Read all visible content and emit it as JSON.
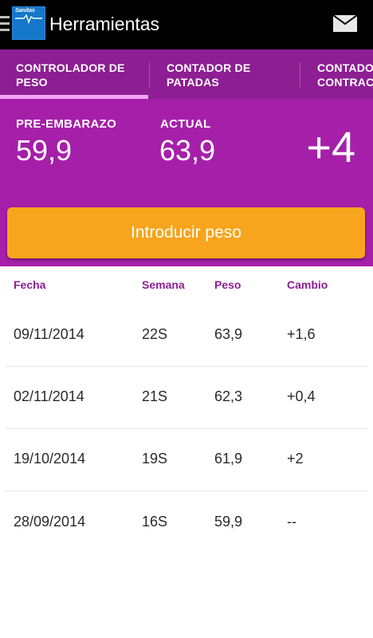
{
  "appbar": {
    "title": "Herramientas",
    "logo_text": "Sanitas",
    "icons": {
      "menu": "menu-icon",
      "mail": "mail-icon"
    }
  },
  "tabs": [
    {
      "label_line1": "CONTROLADOR DE",
      "label_line2": "PESO",
      "selected": true
    },
    {
      "label_line1": "CONTADOR DE",
      "label_line2": "PATADAS",
      "selected": false
    },
    {
      "label_line1": "CONTADOR DE",
      "label_line2": "CONTRACCIONES",
      "selected": false
    }
  ],
  "summary": {
    "pre_label": "PRE-EMBARAZO",
    "pre_value": "59,9",
    "current_label": "ACTUAL",
    "current_value": "63,9",
    "change": "+4"
  },
  "primary_button": {
    "label": "Introducir peso"
  },
  "table": {
    "headers": [
      "Fecha",
      "Semana",
      "Peso",
      "Cambio"
    ],
    "rows": [
      [
        "09/11/2014",
        "22S",
        "63,9",
        "+1,6"
      ],
      [
        "02/11/2014",
        "21S",
        "62,3",
        "+0,4"
      ],
      [
        "19/10/2014",
        "19S",
        "61,9",
        "+2"
      ],
      [
        "28/09/2014",
        "16S",
        "59,9",
        "--"
      ]
    ]
  },
  "colors": {
    "appbar": "#000000",
    "tabs_bg": "#8e1e93",
    "summary_bg": "#a51fa9",
    "accent": "#f7a51c",
    "header_text": "#8e1e93"
  }
}
